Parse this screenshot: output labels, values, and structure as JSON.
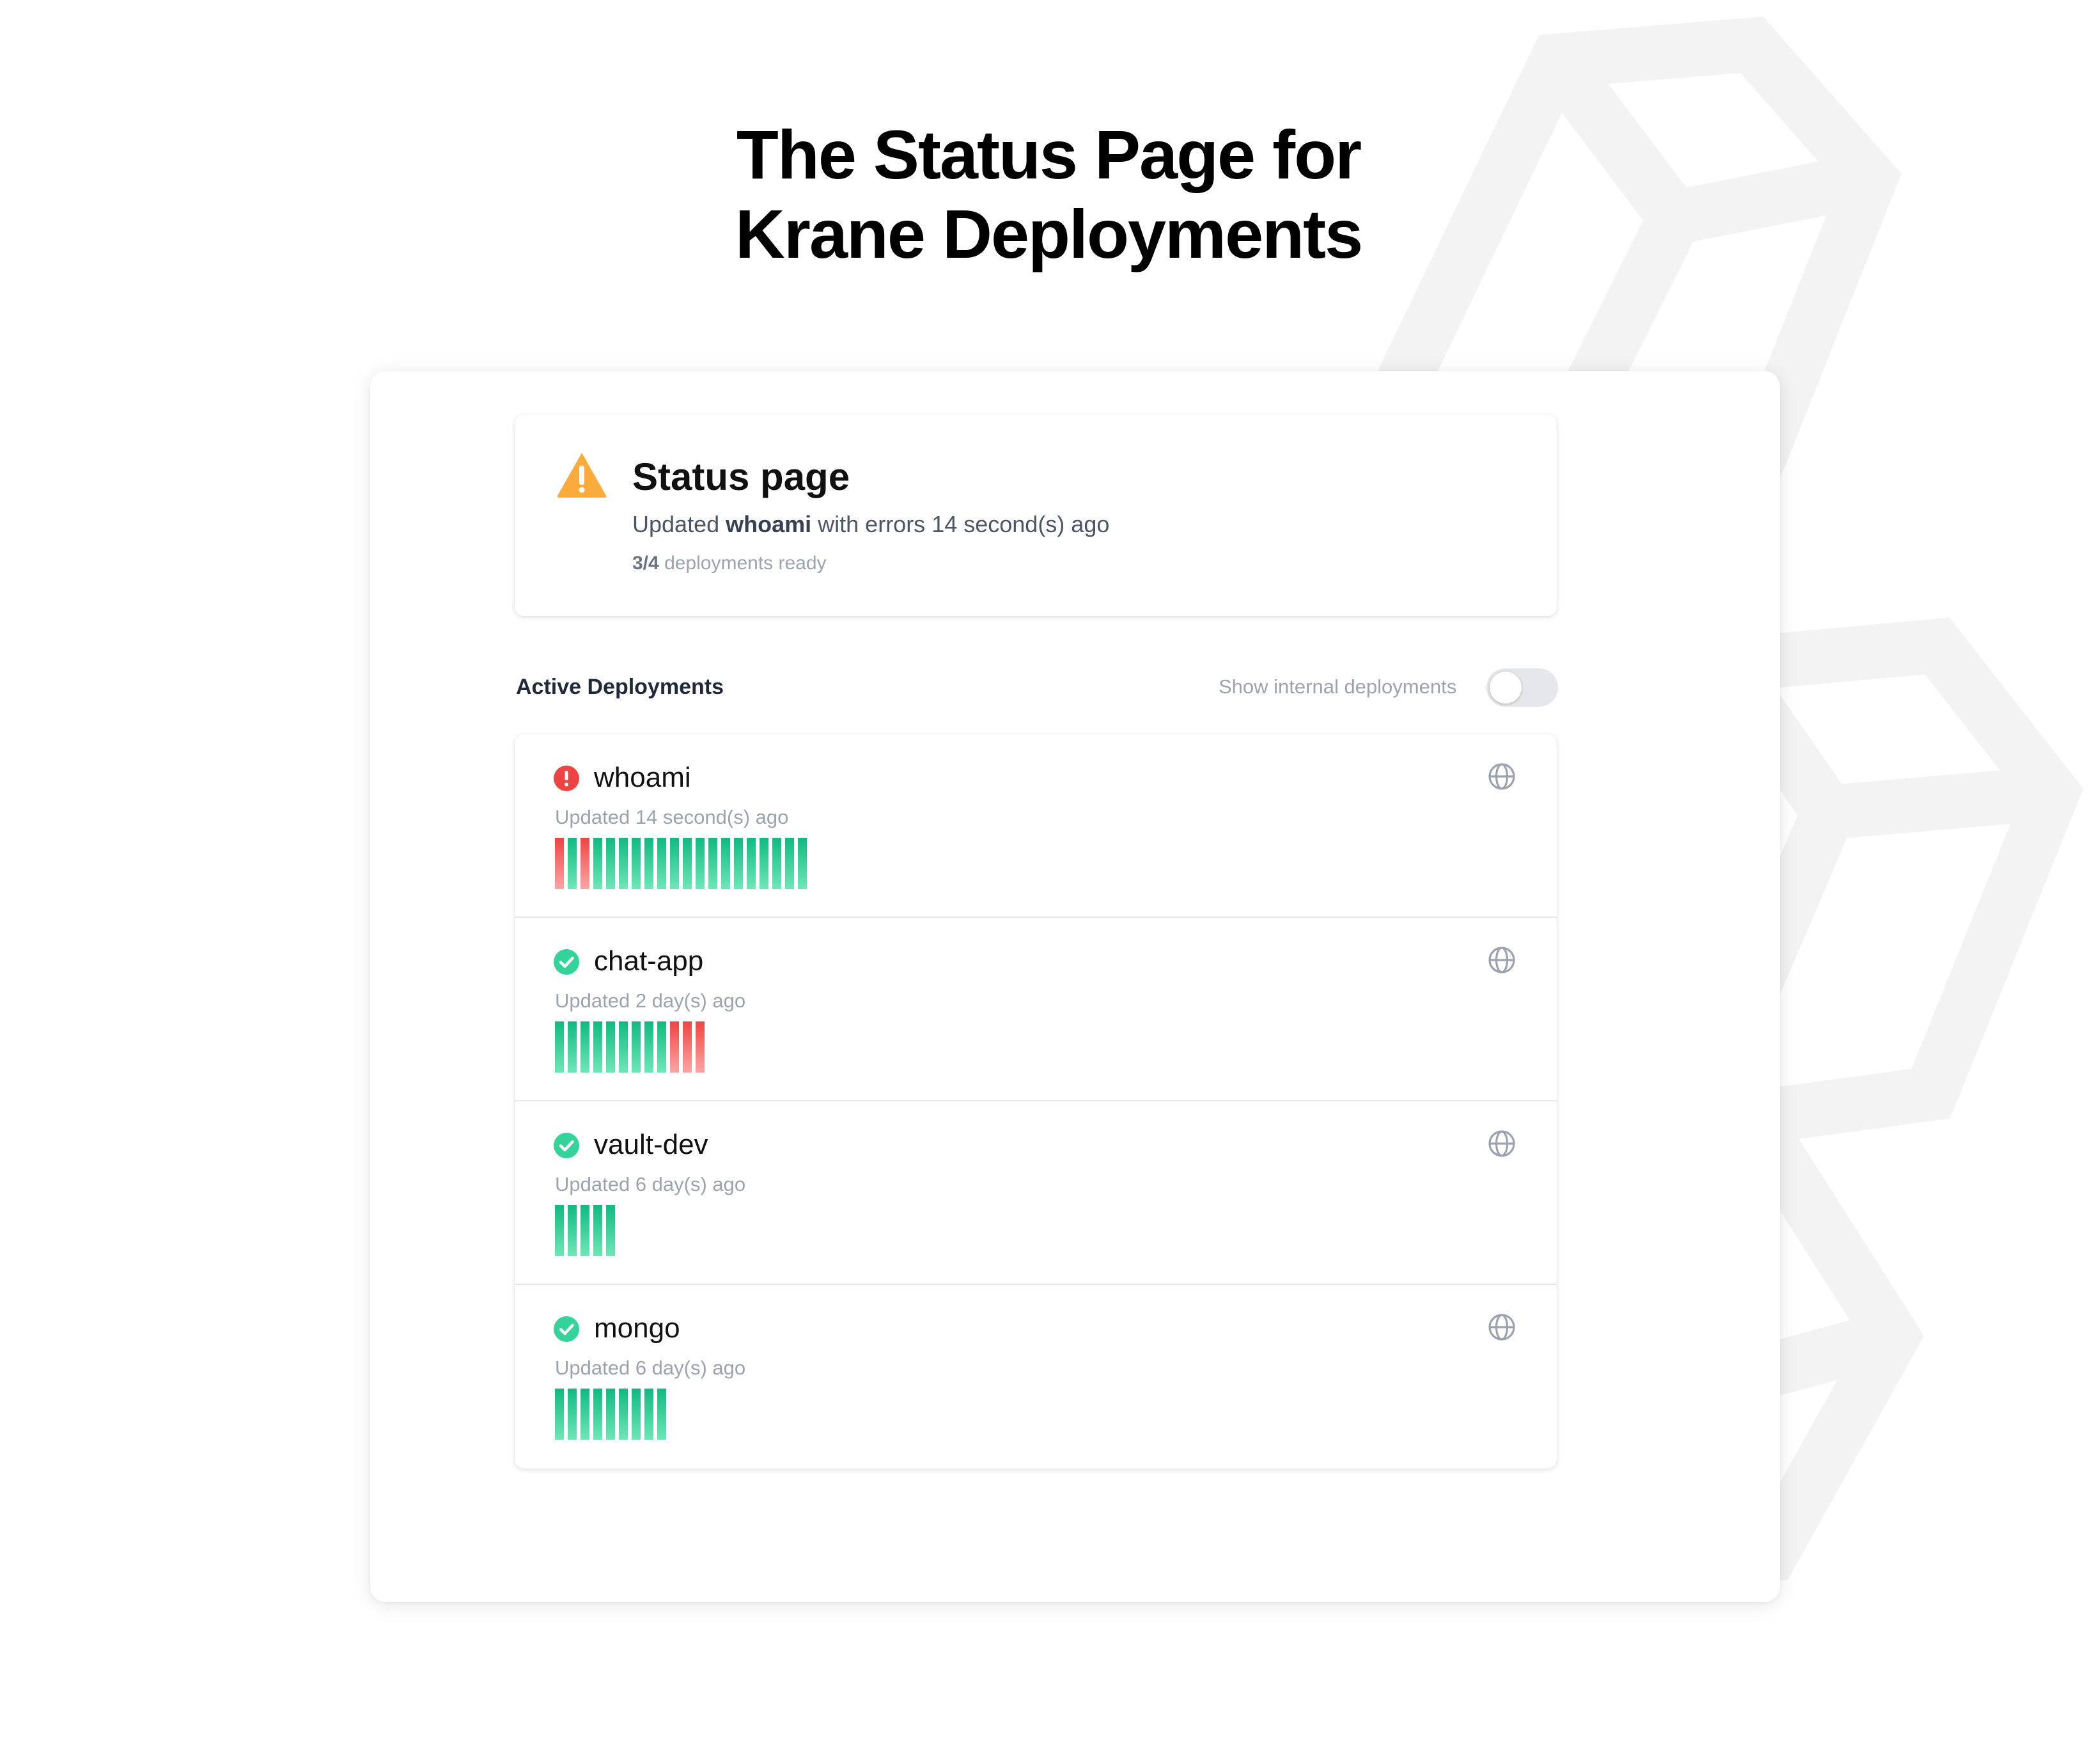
{
  "hero": {
    "line1": "The Status Page for",
    "line2": "Krane Deployments"
  },
  "summary": {
    "icon": "warning-triangle-icon",
    "title": "Status page",
    "updated_prefix": "Updated",
    "updated_name": "whoami",
    "updated_suffix": "with errors 14 second(s) ago",
    "ready_count": "3/4",
    "ready_text": "deployments ready"
  },
  "deployments_section": {
    "label": "Active Deployments",
    "toggle_label": "Show internal deployments",
    "toggle_on": false
  },
  "deployments": [
    {
      "name": "whoami",
      "status": "error",
      "updated": "Updated 14 second(s) ago",
      "history": [
        "err",
        "ok",
        "err",
        "ok",
        "ok",
        "ok",
        "ok",
        "ok",
        "ok",
        "ok",
        "ok",
        "ok",
        "ok",
        "ok",
        "ok",
        "ok",
        "ok",
        "ok",
        "ok",
        "ok"
      ]
    },
    {
      "name": "chat-app",
      "status": "ok",
      "updated": "Updated 2 day(s) ago",
      "history": [
        "ok",
        "ok",
        "ok",
        "ok",
        "ok",
        "ok",
        "ok",
        "ok",
        "ok",
        "err",
        "err",
        "err"
      ]
    },
    {
      "name": "vault-dev",
      "status": "ok",
      "updated": "Updated 6 day(s) ago",
      "history": [
        "ok",
        "ok",
        "ok",
        "ok",
        "ok"
      ]
    },
    {
      "name": "mongo",
      "status": "ok",
      "updated": "Updated 6 day(s) ago",
      "history": [
        "ok",
        "ok",
        "ok",
        "ok",
        "ok",
        "ok",
        "ok",
        "ok",
        "ok"
      ]
    }
  ],
  "colors": {
    "ok": "#10b981",
    "error": "#ef4444",
    "warning": "#fbbf24"
  }
}
